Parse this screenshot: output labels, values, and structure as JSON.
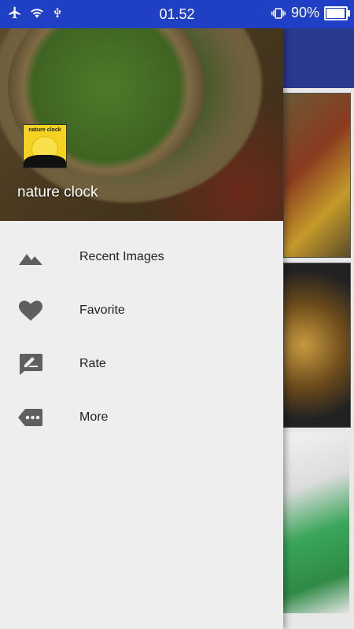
{
  "status_bar": {
    "time": "01.52",
    "battery": "90%",
    "battery_level": 0.9,
    "left_icons": [
      "airplane-icon",
      "wifi-icon",
      "usb-icon"
    ],
    "right_icons": [
      "vibrate-icon",
      "battery-icon"
    ]
  },
  "drawer": {
    "header": {
      "logo_text": "nature clock",
      "title": "nature clock"
    },
    "items": [
      {
        "label": "Recent Images",
        "icon": "landscape-icon"
      },
      {
        "label": "Favorite",
        "icon": "heart-icon"
      },
      {
        "label": "Rate",
        "icon": "rate-review-icon"
      },
      {
        "label": "More",
        "icon": "more-tag-icon"
      }
    ]
  },
  "colors": {
    "status_bar": "#1f3fc4",
    "drawer_bg": "#eeeeee",
    "icon": "#5f5f5f",
    "text": "#222222"
  }
}
